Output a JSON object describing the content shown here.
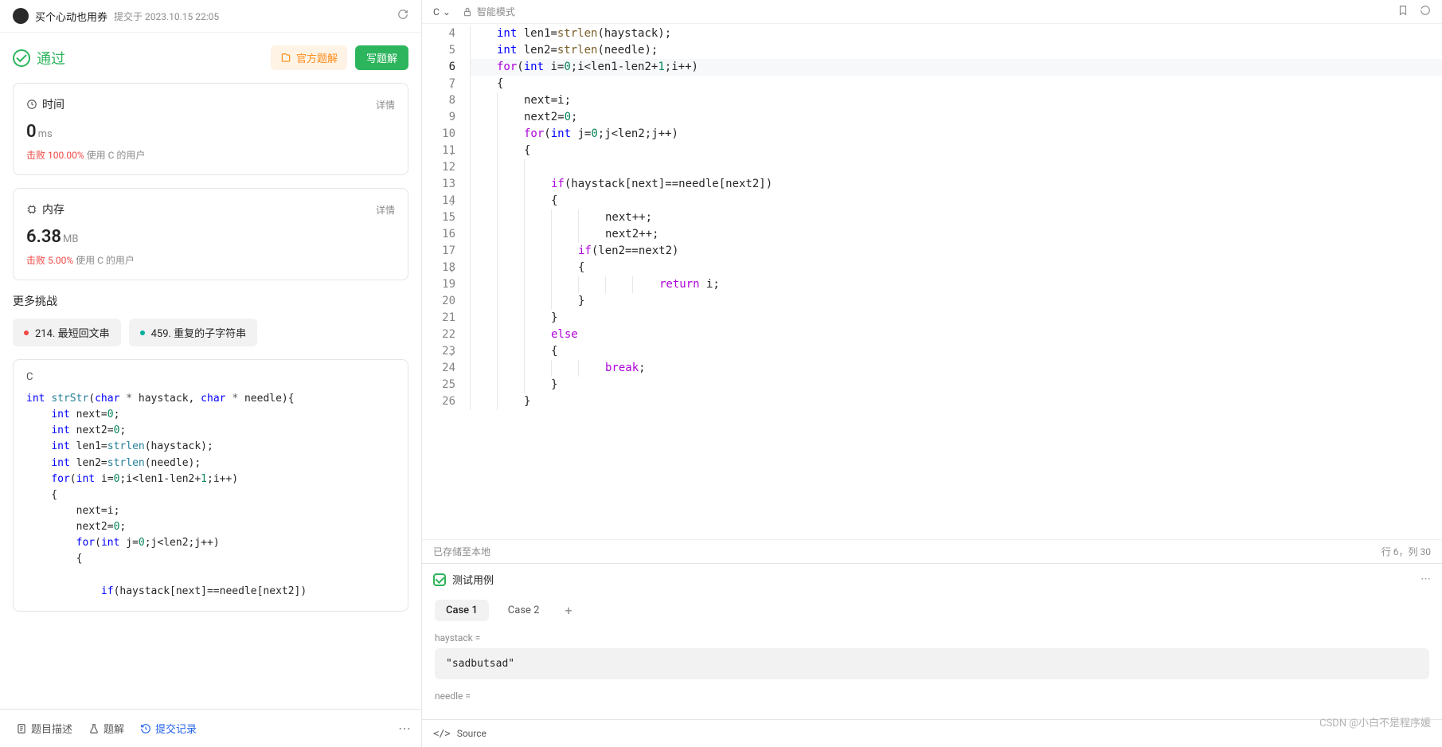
{
  "submission": {
    "username": "买个心动也用券",
    "prefix": "提交于",
    "time": "2023.10.15 22:05",
    "status": "通过",
    "official_btn": "官方题解",
    "write_btn": "写题解"
  },
  "time_stat": {
    "title": "时间",
    "detail": "详情",
    "value": "0",
    "unit": "ms",
    "beat_label": "击败",
    "beat_pct": "100.00%",
    "beat_suffix": "使用 C 的用户"
  },
  "mem_stat": {
    "title": "内存",
    "detail": "详情",
    "value": "6.38",
    "unit": "MB",
    "beat_label": "击败",
    "beat_pct": "5.00%",
    "beat_suffix": "使用 C 的用户"
  },
  "more_title": "更多挑战",
  "challenges": [
    {
      "label": "214. 最短回文串",
      "color": "red"
    },
    {
      "label": "459. 重复的子字符串",
      "color": "teal"
    }
  ],
  "code_preview": {
    "lang": "C"
  },
  "footer_tabs": {
    "desc": "题目描述",
    "solution": "题解",
    "records": "提交记录"
  },
  "editor": {
    "language": "C",
    "mode": "智能模式",
    "save_status": "已存储至本地",
    "cursor": "行 6，列 30"
  },
  "code_lines": [
    {
      "n": 4,
      "indent": 1
    },
    {
      "n": 5,
      "indent": 1
    },
    {
      "n": 6,
      "indent": 1,
      "hl": true
    },
    {
      "n": 7,
      "indent": 1,
      "fold": true
    },
    {
      "n": 8,
      "indent": 2
    },
    {
      "n": 9,
      "indent": 2
    },
    {
      "n": 10,
      "indent": 2
    },
    {
      "n": 11,
      "indent": 2,
      "fold": true
    },
    {
      "n": 12,
      "indent": 3
    },
    {
      "n": 13,
      "indent": 3
    },
    {
      "n": 14,
      "indent": 3,
      "fold": true
    },
    {
      "n": 15,
      "indent": 4
    },
    {
      "n": 16,
      "indent": 4
    },
    {
      "n": 17,
      "indent": 4
    },
    {
      "n": 18,
      "indent": 4,
      "fold": true
    },
    {
      "n": 19,
      "indent": 5
    },
    {
      "n": 20,
      "indent": 4
    },
    {
      "n": 21,
      "indent": 3
    },
    {
      "n": 22,
      "indent": 3
    },
    {
      "n": 23,
      "indent": 3,
      "fold": true
    },
    {
      "n": 24,
      "indent": 4
    },
    {
      "n": 25,
      "indent": 3
    },
    {
      "n": 26,
      "indent": 2
    }
  ],
  "test": {
    "title": "测试用例",
    "cases": [
      "Case 1",
      "Case 2"
    ],
    "active_case": 0,
    "param1_label": "haystack =",
    "param1_value": "\"sadbutsad\"",
    "param2_label": "needle ="
  },
  "bottom": {
    "source": "Source"
  },
  "watermark": "CSDN @小白不是程序媛"
}
